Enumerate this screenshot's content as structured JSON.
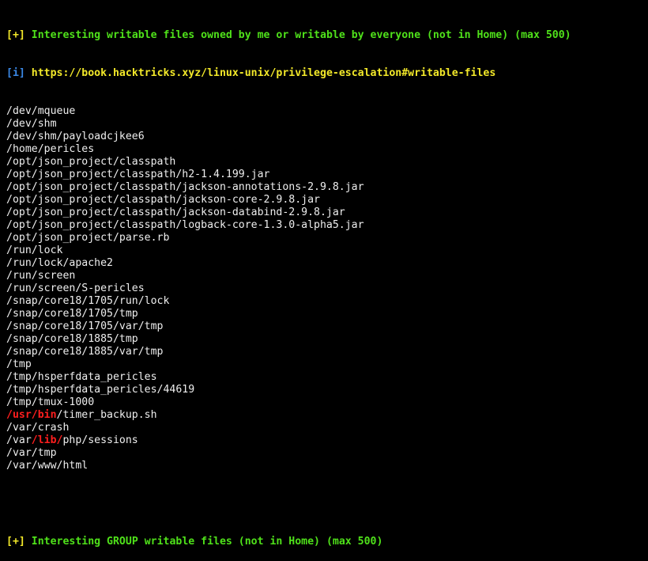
{
  "header_section": {
    "bracket_plus": "[+]",
    "title": "Interesting writable files owned by me or writable by everyone (not in Home) (max 500)",
    "bracket_info": "[i]",
    "link": "https://book.hacktricks.xyz/linux-unix/privilege-escalation#writable-files"
  },
  "files": [
    {
      "segments": [
        {
          "text": "/dev/mqueue",
          "style": "white"
        }
      ]
    },
    {
      "segments": [
        {
          "text": "/dev/shm",
          "style": "white"
        }
      ]
    },
    {
      "segments": [
        {
          "text": "/dev/shm/payloadcjkee6",
          "style": "white"
        }
      ]
    },
    {
      "segments": [
        {
          "text": "/home/pericles",
          "style": "white"
        }
      ]
    },
    {
      "segments": [
        {
          "text": "/opt/json_project/classpath",
          "style": "white"
        }
      ]
    },
    {
      "segments": [
        {
          "text": "/opt/json_project/classpath/h2-1.4.199.jar",
          "style": "white"
        }
      ]
    },
    {
      "segments": [
        {
          "text": "/opt/json_project/classpath/jackson-annotations-2.9.8.jar",
          "style": "white"
        }
      ]
    },
    {
      "segments": [
        {
          "text": "/opt/json_project/classpath/jackson-core-2.9.8.jar",
          "style": "white"
        }
      ]
    },
    {
      "segments": [
        {
          "text": "/opt/json_project/classpath/jackson-databind-2.9.8.jar",
          "style": "white"
        }
      ]
    },
    {
      "segments": [
        {
          "text": "/opt/json_project/classpath/logback-core-1.3.0-alpha5.jar",
          "style": "white"
        }
      ]
    },
    {
      "segments": [
        {
          "text": "/opt/json_project/parse.rb",
          "style": "white"
        }
      ]
    },
    {
      "segments": [
        {
          "text": "/run/lock",
          "style": "white"
        }
      ]
    },
    {
      "segments": [
        {
          "text": "/run/lock/apache2",
          "style": "white"
        }
      ]
    },
    {
      "segments": [
        {
          "text": "/run/screen",
          "style": "white"
        }
      ]
    },
    {
      "segments": [
        {
          "text": "/run/screen/S-pericles",
          "style": "white"
        }
      ]
    },
    {
      "segments": [
        {
          "text": "/snap/core18/1705/run/lock",
          "style": "white"
        }
      ]
    },
    {
      "segments": [
        {
          "text": "/snap/core18/1705/tmp",
          "style": "white"
        }
      ]
    },
    {
      "segments": [
        {
          "text": "/snap/core18/1705/var/tmp",
          "style": "white"
        }
      ]
    },
    {
      "segments": [
        {
          "text": "/snap/core18/1885/tmp",
          "style": "white"
        }
      ]
    },
    {
      "segments": [
        {
          "text": "/snap/core18/1885/var/tmp",
          "style": "white"
        }
      ]
    },
    {
      "segments": [
        {
          "text": "/tmp",
          "style": "white"
        }
      ]
    },
    {
      "segments": [
        {
          "text": "/tmp/hsperfdata_pericles",
          "style": "white"
        }
      ]
    },
    {
      "segments": [
        {
          "text": "/tmp/hsperfdata_pericles/44619",
          "style": "white"
        }
      ]
    },
    {
      "segments": [
        {
          "text": "/tmp/tmux-1000",
          "style": "white"
        }
      ]
    },
    {
      "segments": [
        {
          "text": "/usr/bin",
          "style": "red"
        },
        {
          "text": "/timer_backup.sh",
          "style": "white"
        }
      ]
    },
    {
      "segments": [
        {
          "text": "/var/crash",
          "style": "white"
        }
      ]
    },
    {
      "segments": [
        {
          "text": "/var",
          "style": "white"
        },
        {
          "text": "/lib/",
          "style": "red"
        },
        {
          "text": "php/sessions",
          "style": "white"
        }
      ]
    },
    {
      "segments": [
        {
          "text": "/var/tmp",
          "style": "white"
        }
      ]
    },
    {
      "segments": [
        {
          "text": "/var/www/html",
          "style": "white"
        }
      ]
    }
  ],
  "footer_section": {
    "bracket_plus": "[+]",
    "title": "Interesting GROUP writable files (not in Home) (max 500)"
  },
  "colors": {
    "background": "#000000",
    "text": "#eeeeee",
    "header_green": "#4fe11a",
    "bracket_yellow": "#f2e829",
    "info_blue": "#3a88e6",
    "highlight_red": "#ff1e1e"
  }
}
